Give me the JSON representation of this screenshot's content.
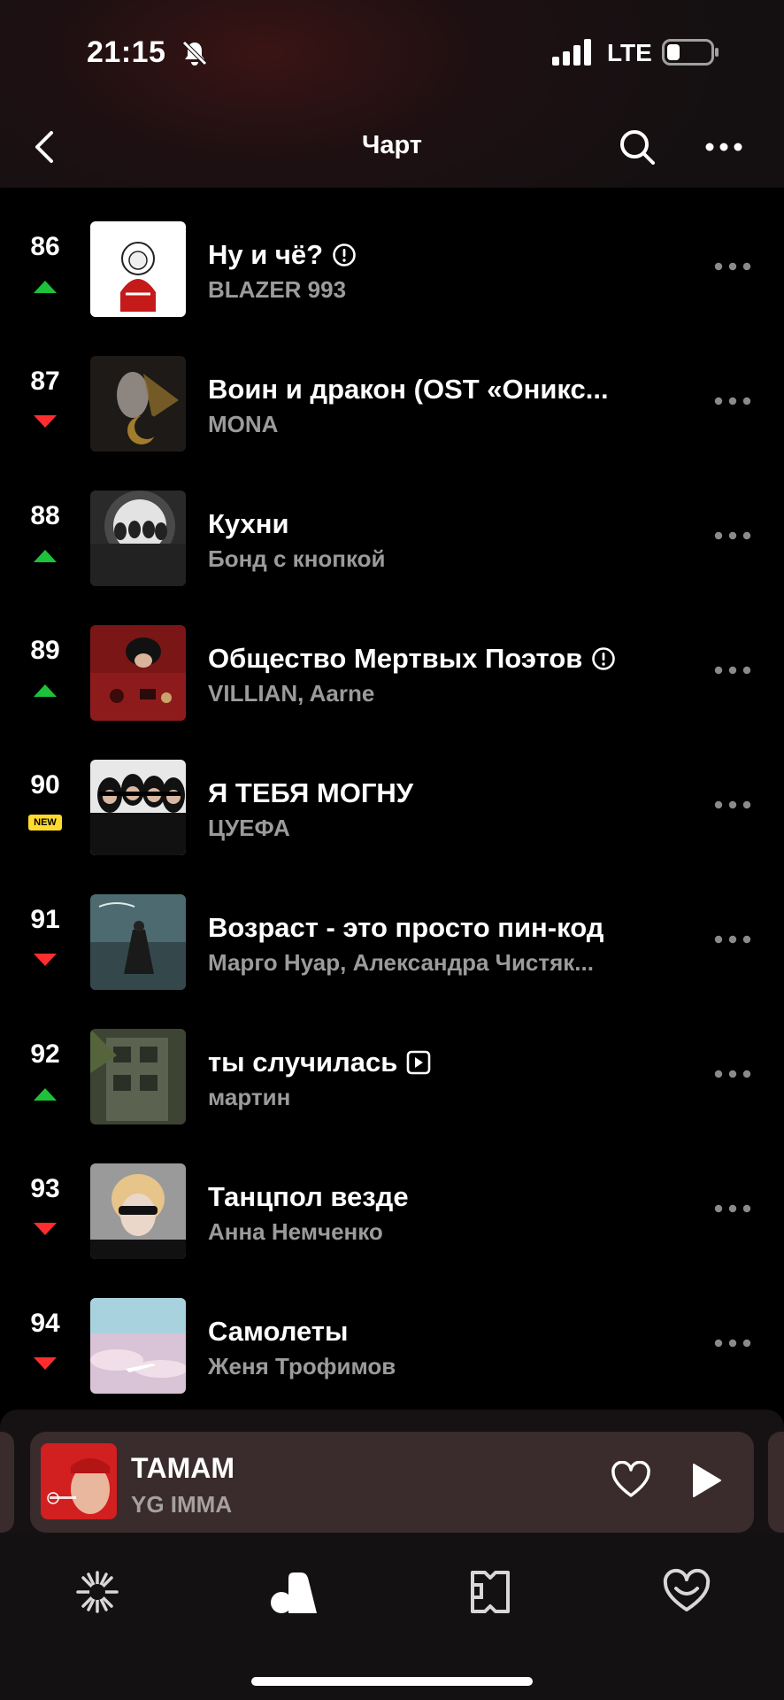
{
  "status_bar": {
    "time": "21:15",
    "network": "LTE",
    "icons": [
      "bell-muted-icon",
      "signal-icon",
      "battery-icon"
    ]
  },
  "header": {
    "title": "Чарт",
    "icons": [
      "back-icon",
      "search-icon",
      "more-icon"
    ]
  },
  "tracks": [
    {
      "rank": "86",
      "trend": "up",
      "title": "Ну и чё?",
      "artist": "BLAZER 993",
      "badge": "explicit-icon"
    },
    {
      "rank": "87",
      "trend": "down",
      "title": "Воин и дракон (OST «Оникс...",
      "artist": "MONA",
      "badge": ""
    },
    {
      "rank": "88",
      "trend": "up",
      "title": "Кухни",
      "artist": "Бонд с кнопкой",
      "badge": ""
    },
    {
      "rank": "89",
      "trend": "up",
      "title": "Общество Мертвых Поэтов",
      "artist": "VILLIAN, Aarne",
      "badge": "explicit-icon"
    },
    {
      "rank": "90",
      "trend": "new",
      "new_label": "NEW",
      "title": "Я ТЕБЯ МОГНУ",
      "artist": "ЦУЕФА",
      "badge": ""
    },
    {
      "rank": "91",
      "trend": "down",
      "title": "Возраст - это просто пин-код",
      "artist": "Марго Нуар, Александра Чистяк...",
      "badge": ""
    },
    {
      "rank": "92",
      "trend": "up",
      "title": "ты случилась",
      "artist": "мартин",
      "badge": "video-icon"
    },
    {
      "rank": "93",
      "trend": "down",
      "title": "Танцпол везде",
      "artist": "Анна Немченко",
      "badge": ""
    },
    {
      "rank": "94",
      "trend": "down",
      "title": "Самолеты",
      "artist": "Женя Трофимов",
      "badge": ""
    }
  ],
  "player": {
    "title": "ТАМАМ",
    "artist": "YG IMMA"
  },
  "tabs": [
    "wave-tab-icon",
    "collection-tab-icon",
    "podcasts-tab-icon",
    "favorites-tab-icon"
  ],
  "colors": {
    "up": "#1ec23a",
    "down": "#ff2d2d",
    "new_badge": "#ffdb2e",
    "player_bg": "#3a2b2d"
  }
}
